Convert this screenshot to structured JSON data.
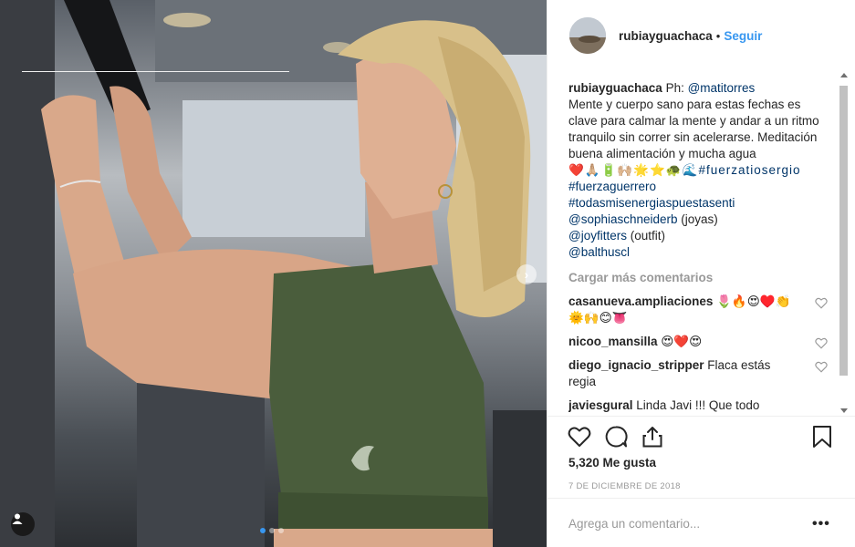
{
  "post": {
    "username": "rubiayguachaca",
    "separator": "•",
    "follow_label": "Seguir",
    "caption": {
      "prefix": "Ph: ",
      "mention": "@matitorres",
      "body": "Mente y cuerpo sano para estas fechas es clave para calmar la mente y andar a un ritmo tranquilo sin correr sin acelerarse. Meditación buena alimentación y mucha agua",
      "emojis": "❤️🙏🏼🔋🙌🏼🌟⭐️🐢🌊",
      "tags": [
        "#fuerzatiosergio",
        "#fuerzaguerrero",
        "#todasmisenergiaspuestasenti"
      ],
      "credits": [
        {
          "mention": "@sophiaschneiderb",
          "note": " (joyas)"
        },
        {
          "mention": "@joyfitters",
          "note": " (outfit)"
        },
        {
          "mention": "@balthuscl",
          "note": ""
        }
      ]
    },
    "load_more_label": "Cargar más comentarios",
    "comments": [
      {
        "user": "casanueva.ampliaciones",
        "text": " 🌷🔥😍♥️👏🌞🙌😊👅"
      },
      {
        "user": "nicoo_mansilla",
        "text": " 😍❤️😍"
      },
      {
        "user": "diego_ignacio_stripper",
        "text": " Flaca estás regia"
      },
      {
        "user": "javiesgural",
        "text": " Linda Javi !!! Que todo"
      }
    ],
    "likes_label": "5,320 Me gusta",
    "date_label": "7 DE DICIEMBRE DE 2018",
    "add_comment_placeholder": "Agrega un comentario...",
    "more_label": "•••",
    "next_arrow": "›"
  },
  "icons": {
    "like": "heart-icon",
    "comment": "comment-icon",
    "share": "share-icon",
    "save": "bookmark-icon",
    "comment_like": "heart-outline-icon",
    "tag_user": "user-icon"
  },
  "colors": {
    "accent_blue": "#3897f0",
    "link": "#003569",
    "muted": "#999999"
  }
}
